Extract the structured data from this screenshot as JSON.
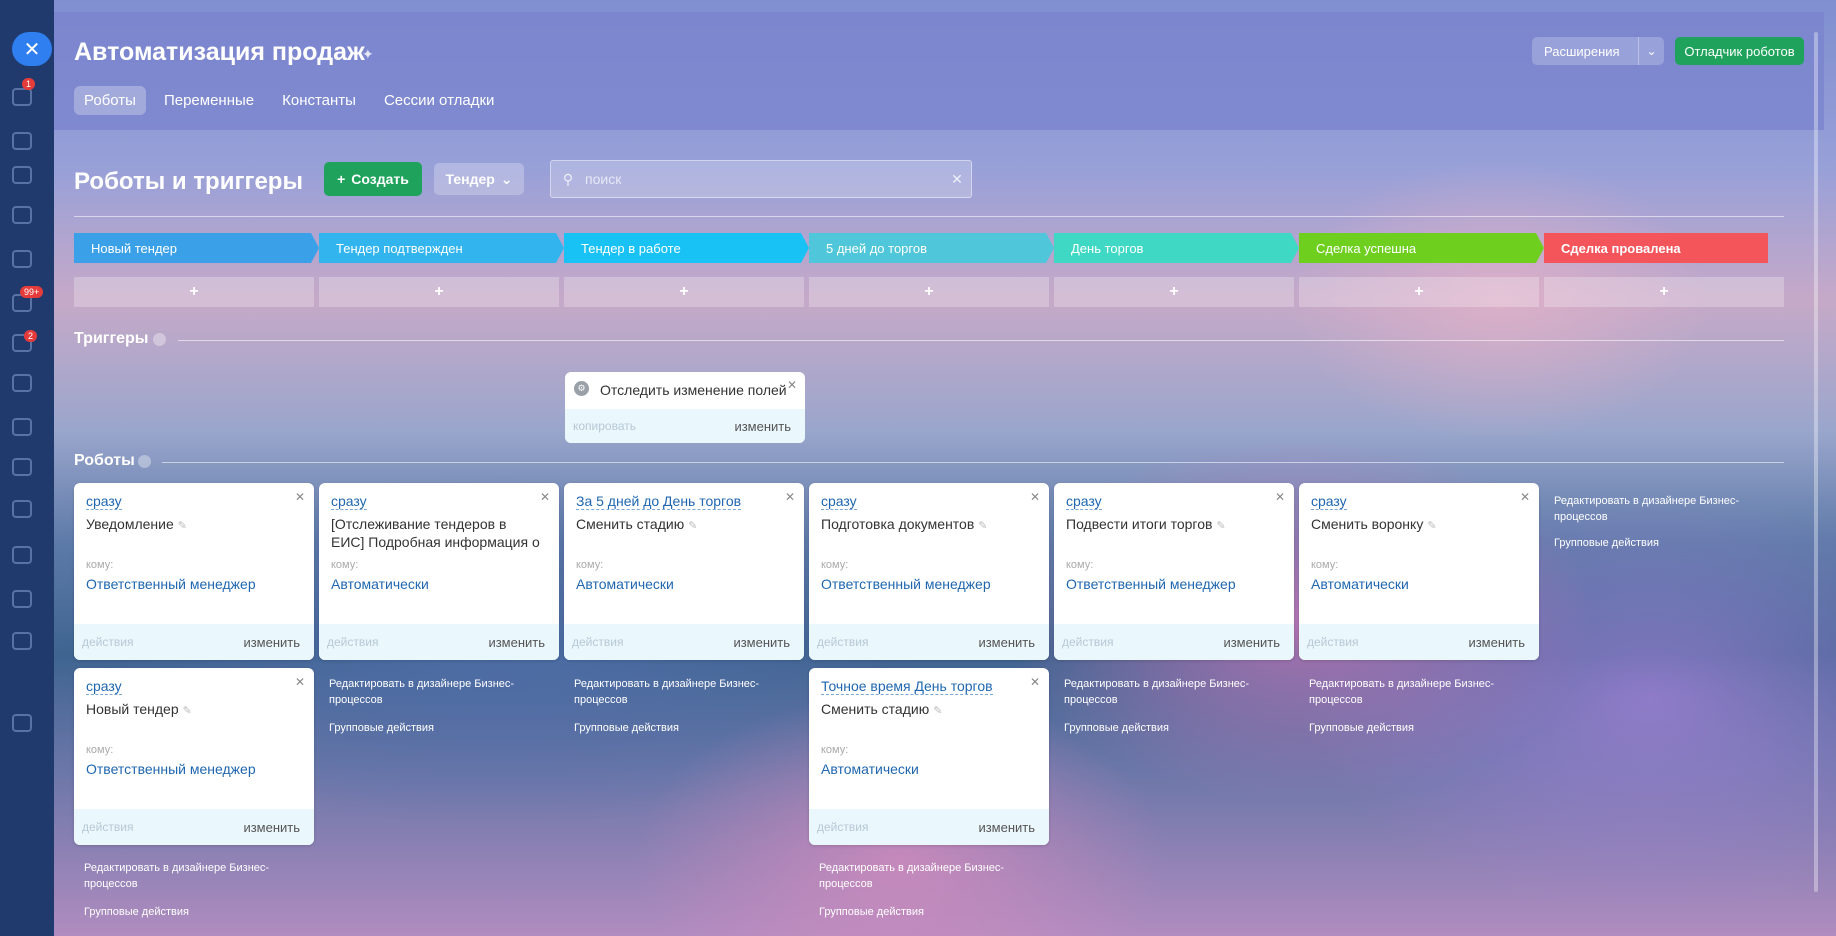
{
  "window": {
    "title": "Автоматизация продаж",
    "close_label": "✕"
  },
  "sidebar_badges": [
    "1",
    "99+",
    "2"
  ],
  "tabs": [
    {
      "label": "Роботы",
      "active": true
    },
    {
      "label": "Переменные",
      "active": false
    },
    {
      "label": "Константы",
      "active": false
    },
    {
      "label": "Сессии отладки",
      "active": false
    }
  ],
  "header_buttons": {
    "extensions": "Расширения",
    "debugger": "Отладчик роботов"
  },
  "toolbar": {
    "title": "Роботы и триггеры",
    "create_label": "Создать",
    "pipeline_label": "Тендер",
    "search_placeholder": "поиск"
  },
  "stages": [
    {
      "label": "Новый тендер",
      "color": "#3aa0e8"
    },
    {
      "label": "Тендер подтвержден",
      "color": "#32b4ee"
    },
    {
      "label": "Тендер в работе",
      "color": "#19c2f5"
    },
    {
      "label": "5 дней до торгов",
      "color": "#4fc6da"
    },
    {
      "label": "День торгов",
      "color": "#3fd8c4"
    },
    {
      "label": "Сделка успешна",
      "color": "#6fcf1f"
    },
    {
      "label": "Сделка провалена",
      "color": "#f4555b"
    }
  ],
  "stage_add_label": "+",
  "triggers": {
    "title": "Триггеры",
    "items": [
      {
        "name": "Отследить изменение полей",
        "copy": "копировать",
        "edit": "изменить"
      }
    ]
  },
  "robots": {
    "title": "Роботы",
    "to_label": "кому:",
    "actions_label": "действия",
    "edit_label": "изменить",
    "items": [
      {
        "when": "сразу",
        "name": "Уведомление",
        "to": "Ответственный менеджер"
      },
      {
        "when": "сразу",
        "name": "[Отслеживание тендеров в ЕИС] Подробная информация о",
        "to": "Автоматически"
      },
      {
        "when": "За 5 дней до День торгов",
        "name": "Сменить стадию",
        "to": "Автоматически"
      },
      {
        "when": "сразу",
        "name": "Подготовка документов",
        "to": "Ответственный менеджер"
      },
      {
        "when": "сразу",
        "name": "Подвести итоги торгов",
        "to": "Ответственный менеджер"
      },
      {
        "when": "сразу",
        "name": "Сменить воронку",
        "to": "Автоматически"
      },
      {
        "when": "сразу",
        "name": "Новый тендер",
        "to": "Ответственный менеджер"
      },
      {
        "when": "Точное время День торгов",
        "name": "Сменить стадию",
        "to": "Автоматически"
      }
    ],
    "designer_link": "Редактировать в дизайнере Бизнес-процессов",
    "group_actions": "Групповые действия"
  },
  "colors": {
    "accent_green": "#1fa35c",
    "link_blue": "#2067b0",
    "close_blue": "#2f7ff0"
  }
}
